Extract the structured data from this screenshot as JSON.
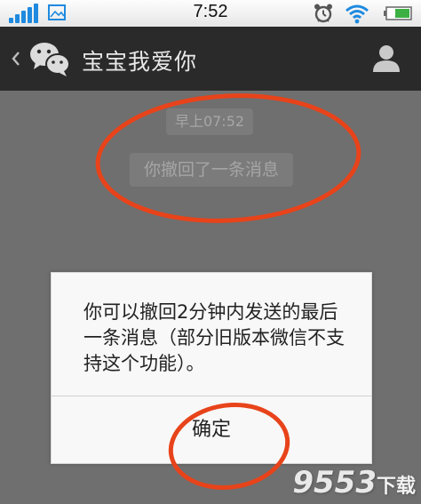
{
  "status_bar": {
    "time": "7:52",
    "icons": [
      "signal-icon",
      "picture-icon",
      "alarm-icon",
      "wifi-icon",
      "battery-icon"
    ],
    "signal_color": "#1e8ae0",
    "battery_color": "#3cb043"
  },
  "header": {
    "back_icon": "chevron-left-icon",
    "app_icon": "wechat-icon",
    "title": "宝宝我爱你",
    "profile_icon": "person-icon"
  },
  "chat": {
    "timestamp": "早上07:52",
    "recall_notice": "你撤回了一条消息"
  },
  "dialog": {
    "message": "你可以撤回2分钟内发送的最后一条消息（部分旧版本微信不支持这个功能）。",
    "confirm_label": "确定"
  },
  "annotation_color": "#e8431a",
  "watermark": {
    "number": "9553",
    "text": "下载"
  }
}
